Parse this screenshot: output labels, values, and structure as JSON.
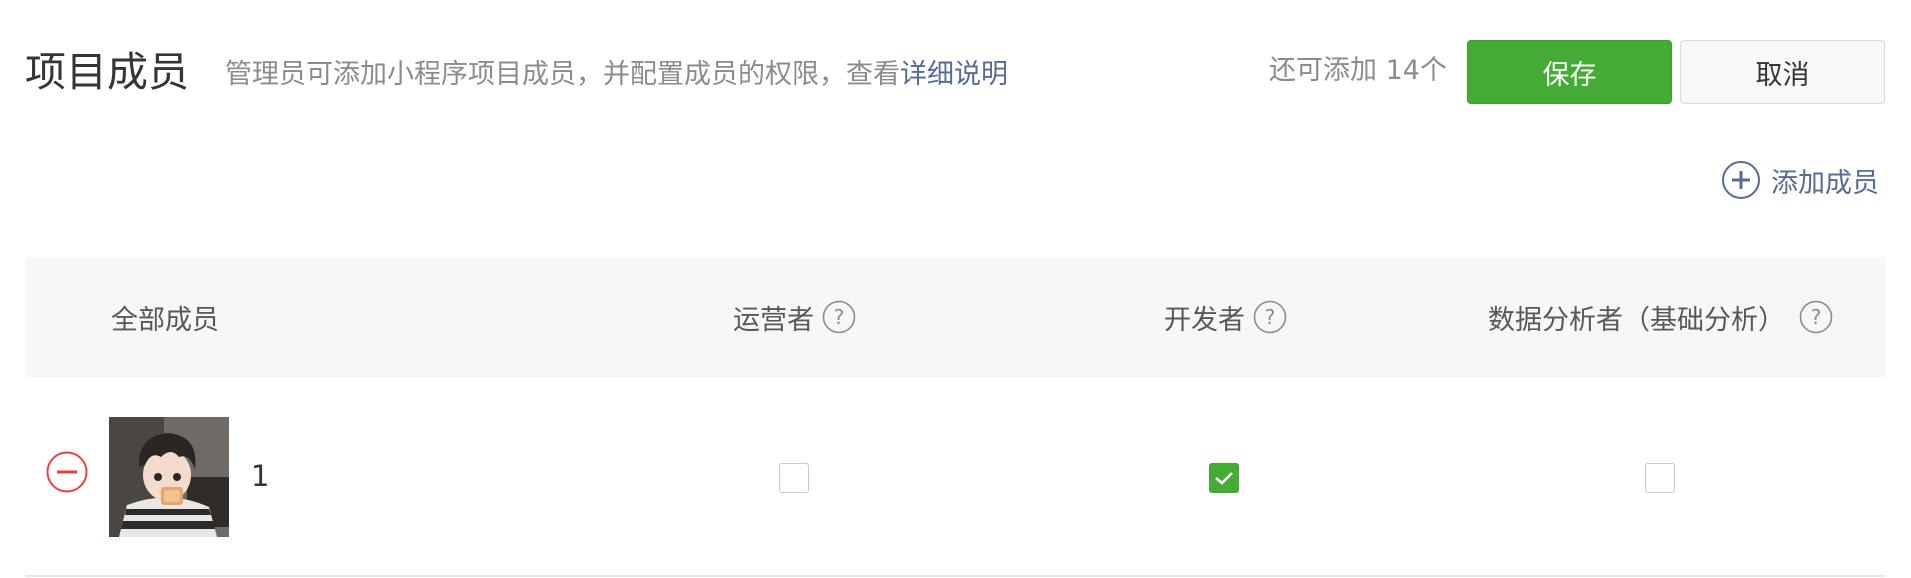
{
  "header": {
    "title": "项目成员",
    "description": "管理员可添加小程序项目成员，并配置成员的权限，查看",
    "detail_link": "详细说明",
    "remaining": "还可添加 14个",
    "save_label": "保存",
    "cancel_label": "取消"
  },
  "add_member": {
    "label": "添加成员",
    "icon": "plus-circle-icon"
  },
  "table": {
    "columns": [
      {
        "label": "全部成员",
        "help": false
      },
      {
        "label": "运营者",
        "help": true
      },
      {
        "label": "开发者",
        "help": true
      },
      {
        "label": "数据分析者（基础分析）",
        "help": true
      }
    ],
    "rows": [
      {
        "name": "1",
        "avatar": "member-avatar",
        "permissions": {
          "operator": false,
          "developer": true,
          "analyst": false
        }
      }
    ]
  },
  "colors": {
    "primary_green": "#44ab35",
    "link_blue": "#576b95",
    "remove_red": "#e64340",
    "header_bg": "#f6f7f8"
  }
}
